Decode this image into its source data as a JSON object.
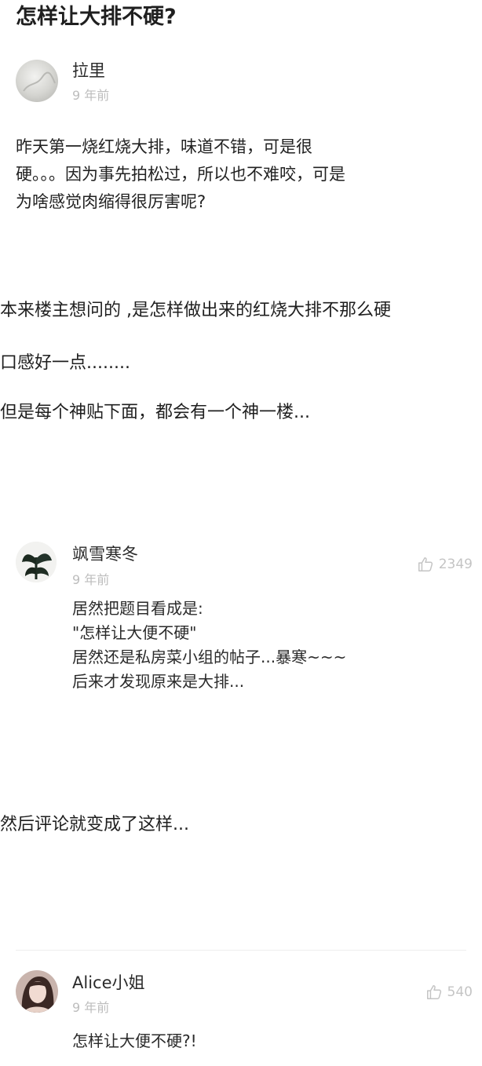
{
  "post": {
    "title": "怎样让大排不硬?",
    "author": {
      "name": "拉里",
      "time": "9 年前"
    },
    "body_lines": [
      "昨天第一烧红烧大排，味道不错，可是很",
      "硬。。。因为事先拍松过，所以也不难咬，可是",
      "为啥感觉肉缩得很厉害呢?"
    ]
  },
  "caption_1": {
    "lines": [
      "本来楼主想问的 ,是怎样做出来的红烧大排不那么硬",
      "口感好一点........",
      "但是每个神贴下面，都会有一个神一楼..."
    ]
  },
  "reply_1": {
    "name": "飒雪寒冬",
    "time": "9 年前",
    "likes": "2349",
    "lines": [
      "居然把题目看成是:",
      "\"怎样让大便不硬\"",
      "居然还是私房菜小组的帖子...暴寒~~~",
      "后来才发现原来是大排..."
    ]
  },
  "caption_2": {
    "text": "然后评论就变成了这样..."
  },
  "reply_2": {
    "name": "Alice小姐",
    "time": "9 年前",
    "likes": "540",
    "text": "怎样让大便不硬?!"
  },
  "icons": {
    "avatar_1": "gray-avatar",
    "avatar_2": "plant-avatar",
    "avatar_3": "portrait-avatar",
    "like": "thumbs-up-icon"
  },
  "colors": {
    "text": "#1f1f1f",
    "muted": "#bdbdbd",
    "like": "#c4c4c4"
  }
}
